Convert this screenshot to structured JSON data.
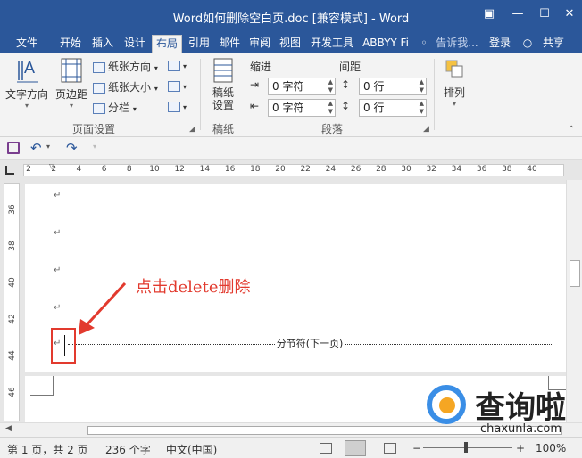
{
  "window": {
    "title": "Word如何删除空白页.doc [兼容模式] - Word",
    "help_icon": "?",
    "restore_icon": "▣",
    "minimize_icon": "—",
    "maximize_icon": "☐",
    "close_icon": "✕"
  },
  "tabs": [
    "文件",
    "开始",
    "插入",
    "设计",
    "布局",
    "引用",
    "邮件",
    "审阅",
    "视图",
    "开发工具",
    "ABBYY Fi"
  ],
  "active_tab": "布局",
  "tell_me": "告诉我...",
  "login": "登录",
  "share": "共享",
  "ribbon": {
    "text_direction": "文字方向",
    "margins": "页边距",
    "orientation": "纸张方向",
    "size": "纸张大小",
    "columns": "分栏",
    "page_setup_group": "页面设置",
    "manuscript": "稿纸\n设置",
    "manuscript_group": "稿纸",
    "indent_label": "缩进",
    "spacing_label": "间距",
    "indent_left": "0 字符",
    "indent_right": "0 字符",
    "spacing_before": "0 行",
    "spacing_after": "0 行",
    "paragraph_group": "段落",
    "arrange": "排列"
  },
  "ruler": {
    "h_numbers": [
      "2",
      "2",
      "4",
      "6",
      "8",
      "10",
      "12",
      "14",
      "16",
      "18",
      "20",
      "22",
      "24",
      "26",
      "28",
      "30",
      "32",
      "34",
      "36",
      "38",
      "40"
    ],
    "v_numbers": [
      "36",
      "38",
      "40",
      "42",
      "44",
      "46"
    ]
  },
  "document": {
    "paragraph_mark": "↵",
    "section_break": "分节符(下一页)",
    "annotation": "点击delete删除"
  },
  "status": {
    "page": "第 1 页，共 2 页",
    "words": "236 个字",
    "language": "中文(中国)",
    "zoom": "100%",
    "zoom_minus": "−",
    "zoom_plus": "+"
  },
  "watermark": {
    "brand": "查询啦",
    "url": "chaxunla.com"
  }
}
